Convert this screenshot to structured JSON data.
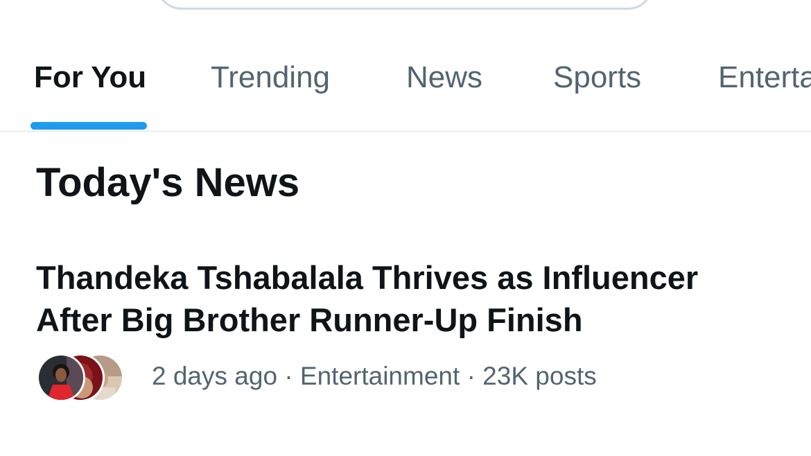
{
  "tabs": [
    {
      "label": "For You",
      "active": true
    },
    {
      "label": "Trending",
      "active": false
    },
    {
      "label": "News",
      "active": false
    },
    {
      "label": "Sports",
      "active": false
    },
    {
      "label": "Entertainment",
      "active": false
    }
  ],
  "section": {
    "title": "Today's News"
  },
  "news_item": {
    "headline_line1": "Thandeka Tshabalala Thrives as Influencer",
    "headline_line2": "After Big Brother Runner-Up Finish",
    "time": "2 days ago",
    "separator": "·",
    "category": "Entertainment",
    "posts": "23K posts"
  },
  "colors": {
    "accent": "#1d9bf0",
    "text_primary": "#0f1419",
    "text_secondary": "#536471",
    "divider": "#eff3f4"
  }
}
